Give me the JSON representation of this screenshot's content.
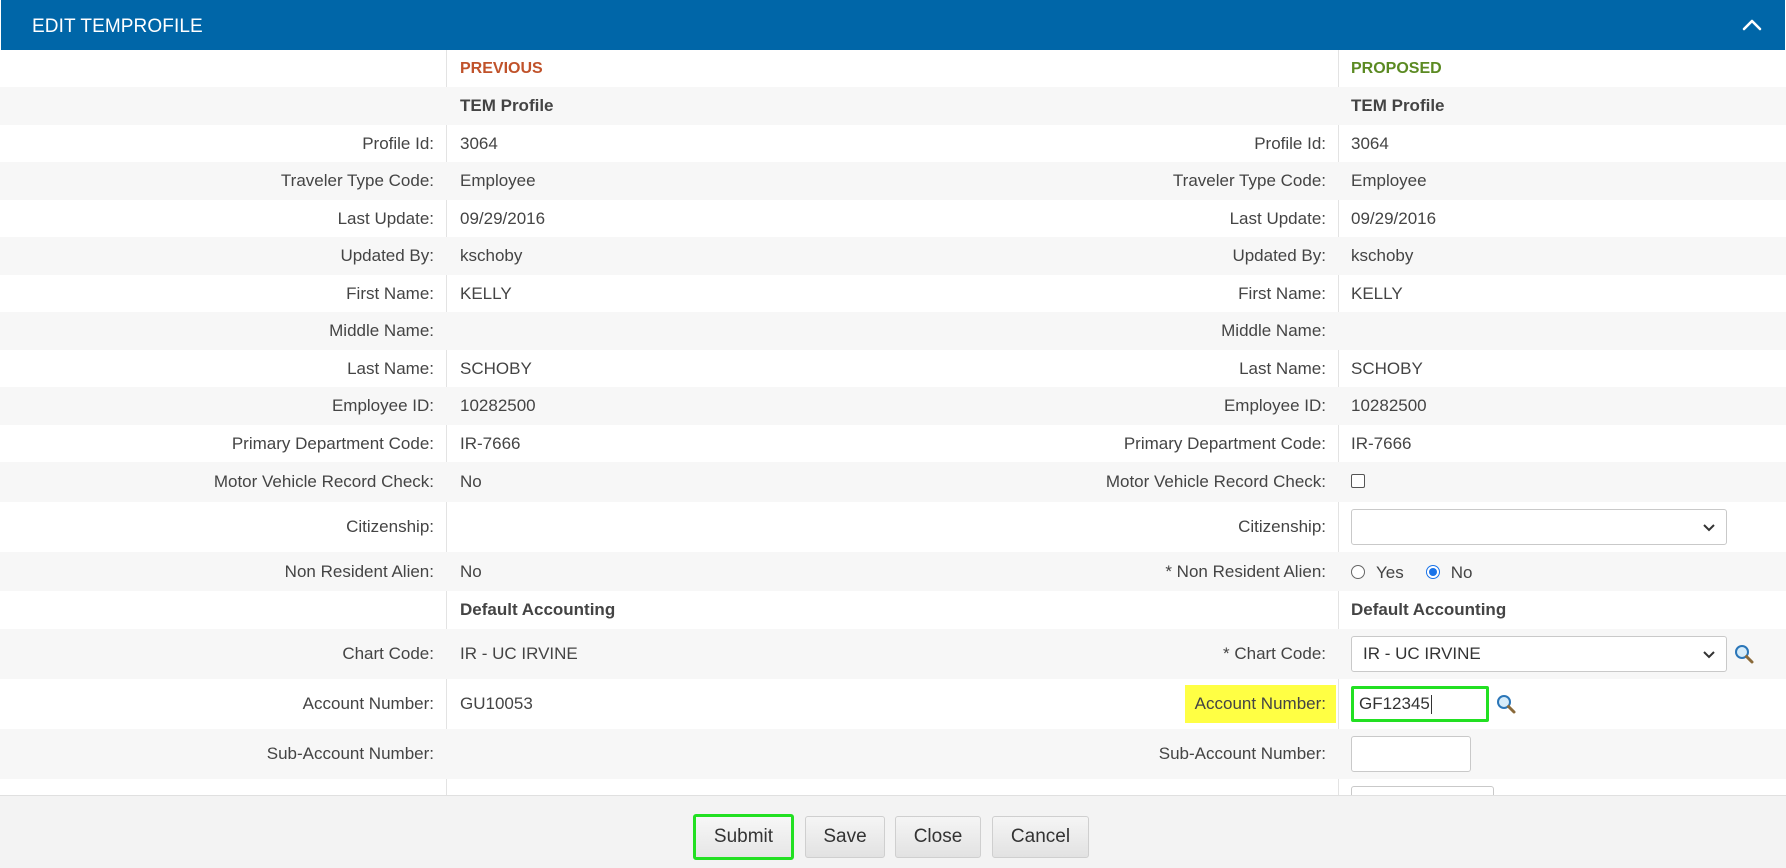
{
  "header": {
    "title": "EDIT TEMPROFILE",
    "collapse_icon": "chevron-up-icon"
  },
  "columns": {
    "previous": "PREVIOUS",
    "proposed": "PROPOSED"
  },
  "section_tem_profile": "TEM Profile",
  "section_default_accounting": "Default Accounting",
  "rows": {
    "profile_id": {
      "label": "Profile Id:",
      "prev": "3064",
      "prop": "3064"
    },
    "traveler_type": {
      "label": "Traveler Type Code:",
      "prev": "Employee",
      "prop": "Employee"
    },
    "last_update": {
      "label": "Last Update:",
      "prev": "09/29/2016",
      "prop": "09/29/2016"
    },
    "updated_by": {
      "label": "Updated By:",
      "prev": "kschoby",
      "prop": "kschoby"
    },
    "first_name": {
      "label": "First Name:",
      "prev": "KELLY",
      "prop": "KELLY"
    },
    "middle_name": {
      "label": "Middle Name:",
      "prev": "",
      "prop": ""
    },
    "last_name": {
      "label": "Last Name:",
      "prev": "SCHOBY",
      "prop": "SCHOBY"
    },
    "employee_id": {
      "label": "Employee ID:",
      "prev": "10282500",
      "prop": "10282500"
    },
    "dept_code": {
      "label": "Primary Department Code:",
      "prev": "IR-7666",
      "prop": "IR-7666"
    },
    "mvr_check": {
      "label": "Motor Vehicle Record Check:",
      "prev": "No",
      "prop_checked": false
    },
    "citizenship": {
      "label": "Citizenship:",
      "prev": "",
      "prop_selected": ""
    },
    "non_resident_alien": {
      "label": "Non Resident Alien:",
      "prop_label": "*  Non Resident Alien:",
      "prev": "No",
      "options": [
        "Yes",
        "No"
      ],
      "selected": "No"
    },
    "chart_code": {
      "label": "Chart Code:",
      "prop_label": "*  Chart Code:",
      "prev": "IR - UC IRVINE",
      "prop_selected": "IR - UC IRVINE"
    },
    "account_number": {
      "label": "Account Number:",
      "prev": "GU10053",
      "prop_value": "GF12345"
    },
    "sub_account": {
      "label": "Sub-Account Number:",
      "prev": "",
      "prop_value": ""
    }
  },
  "buttons": {
    "submit": "Submit",
    "save": "Save",
    "close": "Close",
    "cancel": "Cancel"
  },
  "colors": {
    "header_bg": "#0066a8",
    "previous": "#c0522a",
    "proposed": "#5b8a22",
    "highlight": "#ffff44",
    "focus_outline": "#22e022",
    "radio_selected": "#1a73e8"
  }
}
